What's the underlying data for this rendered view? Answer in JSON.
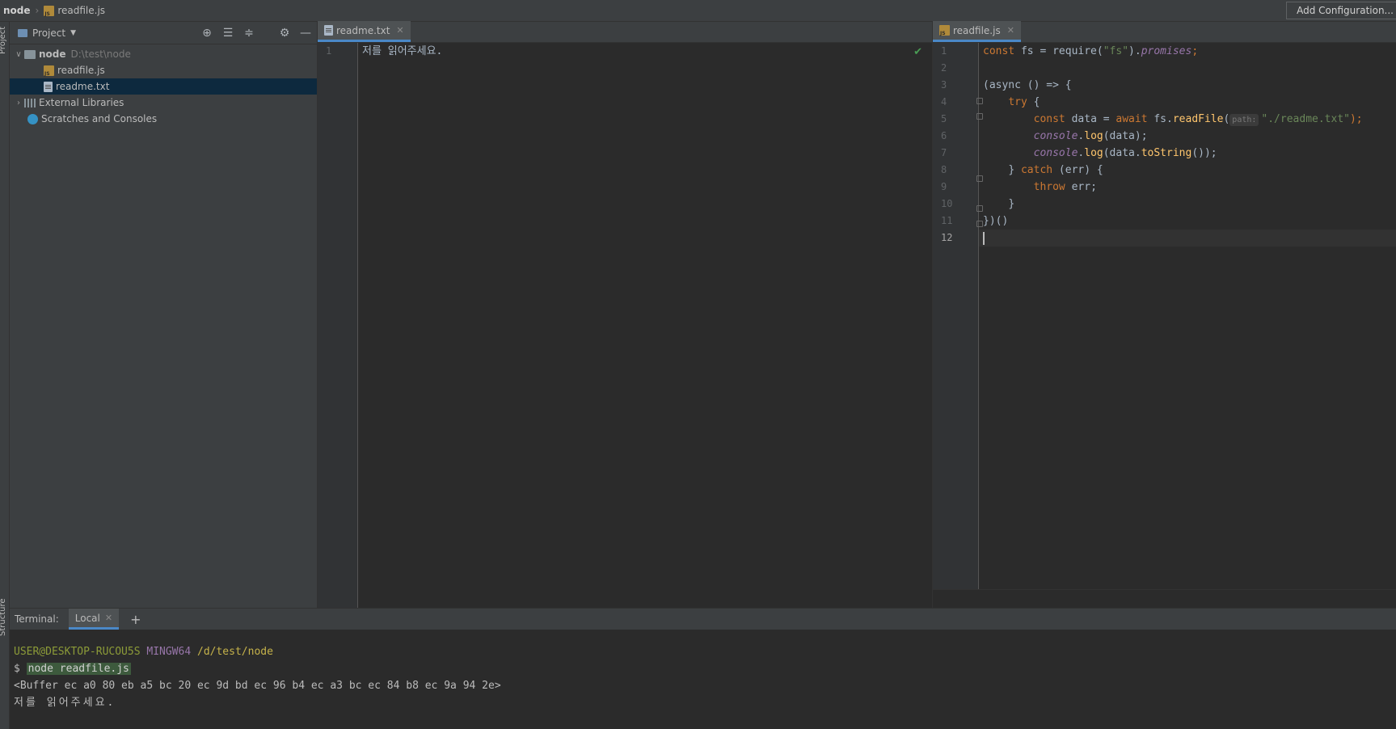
{
  "navbar": {
    "project": "node",
    "file": "readfile.js",
    "add_configuration": "Add Configuration..."
  },
  "left_stripe": {
    "project_label": "Project",
    "structure_label": "Structure"
  },
  "project_panel": {
    "title": "Project",
    "tree": {
      "root": {
        "name": "node",
        "path": "D:\\test\\node"
      },
      "files": [
        "readfile.js",
        "readme.txt"
      ],
      "external": "External Libraries",
      "scratches": "Scratches and Consoles"
    }
  },
  "editor_left": {
    "tab": "readme.txt",
    "lines": [
      "저를 읽어주세요."
    ]
  },
  "editor_right": {
    "tab": "readfile.js",
    "param_hint": "path:",
    "code": {
      "l1_const": "const",
      "l1_rest": " fs = require(",
      "l1_str": "\"fs\"",
      "l1_close": ").",
      "l1_prop": "promises",
      "l1_end": ";",
      "l3": "(async () => {",
      "l4_kw": "try",
      "l4_rest": " {",
      "l5_const": "const",
      "l5_mid": " data = ",
      "l5_await": "await",
      "l5_fs": " fs.",
      "l5_fn": "readFile",
      "l5_open": "(",
      "l5_str": "\"./readme.txt\"",
      "l5_end": ");",
      "l6_obj": "console",
      "l6_dot": ".",
      "l6_fn": "log",
      "l6_rest": "(data);",
      "l7_obj": "console",
      "l7_dot": ".",
      "l7_fn": "log",
      "l7_mid": "(data.",
      "l7_fn2": "toString",
      "l7_end": "());",
      "l8_close": "} ",
      "l8_kw": "catch",
      "l8_rest": " (err) {",
      "l9_kw": "throw",
      "l9_rest": " err;",
      "l10": "}",
      "l11": "})()"
    }
  },
  "terminal": {
    "label": "Terminal:",
    "tab": "Local",
    "user": "USER@DESKTOP-RUCOU5S",
    "system": "MINGW64",
    "cwd": "/d/test/node",
    "prompt": "$",
    "command": "node readfile.js",
    "buffer_output": "<Buffer ec a0 80 eb a5 bc 20 ec 9d bd ec 96 b4 ec a3 bc ec 84 b8 ec 9a 94 2e>",
    "string_output": "저를 읽어주세요."
  }
}
